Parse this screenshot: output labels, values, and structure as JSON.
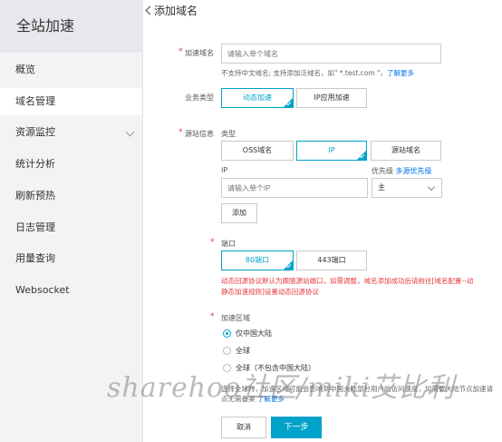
{
  "sidebar": {
    "title": "全站加速",
    "items": [
      {
        "label": "概览"
      },
      {
        "label": "域名管理"
      },
      {
        "label": "资源监控"
      },
      {
        "label": "统计分析"
      },
      {
        "label": "刷新预热"
      },
      {
        "label": "日志管理"
      },
      {
        "label": "用量查询"
      },
      {
        "label": "Websocket"
      }
    ]
  },
  "page": {
    "title": "添加域名"
  },
  "form": {
    "domain": {
      "label": "加速域名",
      "placeholder": "请输入单个域名",
      "hint": "不支持中文域名; 支持添加泛域名，如\" *.test.com \"，",
      "hint_link": "了解更多"
    },
    "biz_type": {
      "label": "业务类型",
      "options": [
        "动态加速",
        "IP应用加速"
      ],
      "selected": "动态加速"
    },
    "origin": {
      "label": "源站信息",
      "type_label": "类型",
      "types": [
        "OSS域名",
        "IP",
        "源站域名"
      ],
      "selected": "IP",
      "ip_label": "IP",
      "ip_placeholder": "请输入单个IP",
      "priority_label": "优先级",
      "priority_link": "多源优先级",
      "priority_value": "主",
      "add_label": "添加"
    },
    "port": {
      "label": "端口",
      "options": [
        "80端口",
        "443端口"
      ],
      "selected": "80端口",
      "warning_line1": "动态回源协议默认为跟随源站端口，如需调整，域名添加成功后请前往[域名配置--动",
      "warning_line2": "静态加速规则]设置动态回源协议"
    },
    "region": {
      "label": "加速区域",
      "options": [
        "仅中国大陆",
        "全球",
        "全球（不包含中国大陆）"
      ],
      "selected": "仅中国大陆",
      "hint_line1": "选择全球时，加速区域可能会影响到中国大陆部分用户的访问速度，如需要大陆节点加速请",
      "hint_line2": "点无需备案",
      "hint_link": "了解更多"
    },
    "cancel_label": "取消",
    "next_label": "下一步"
  },
  "watermark": "sharehoo社区/miki艾比利"
}
